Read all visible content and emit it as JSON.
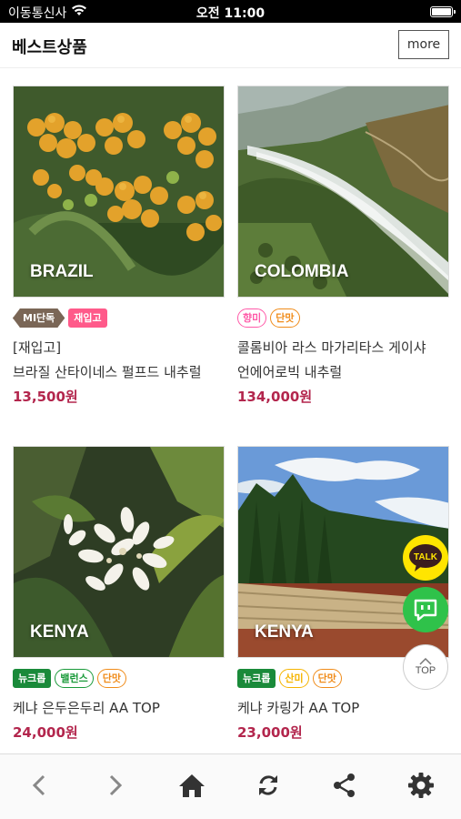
{
  "status_bar": {
    "carrier": "이동통신사",
    "time": "오전 11:00"
  },
  "header": {
    "title": "베스트상품",
    "more_label": "more"
  },
  "products": [
    {
      "region": "BRAZIL",
      "tags": [
        {
          "label": "MI단독",
          "color": "#7a6656",
          "style": "hex-filled"
        },
        {
          "label": "재입고",
          "color": "#ff5a8a",
          "style": "square-filled"
        }
      ],
      "name": "[재입고]\n브라질 산타이네스 펄프드 내추럴",
      "price": "13,500원"
    },
    {
      "region": "COLOMBIA",
      "tags": [
        {
          "label": "향미",
          "color": "#ff5aa8",
          "style": "outline"
        },
        {
          "label": "단맛",
          "color": "#f08c1a",
          "style": "outline"
        }
      ],
      "name": "콜롬비아 라스 마가리타스 게이샤\n언에어로빅 내추럴",
      "price": "134,000원"
    },
    {
      "region": "KENYA",
      "tags": [
        {
          "label": "뉴크롭",
          "color": "#1a8a3a",
          "style": "square-filled"
        },
        {
          "label": "밸런스",
          "color": "#1a9a3a",
          "style": "outline"
        },
        {
          "label": "단맛",
          "color": "#f08c1a",
          "style": "outline"
        }
      ],
      "name": "케냐 은두은두리 AA TOP",
      "price": "24,000원"
    },
    {
      "region": "KENYA",
      "tags": [
        {
          "label": "뉴크롭",
          "color": "#1a8a3a",
          "style": "square-filled"
        },
        {
          "label": "산미",
          "color": "#f5b400",
          "style": "outline"
        },
        {
          "label": "단맛",
          "color": "#f08c1a",
          "style": "outline"
        }
      ],
      "name": "케냐 카링가 AA TOP",
      "price": "23,000원"
    }
  ],
  "floating": {
    "talk_label": "TALK",
    "top_label": "TOP"
  },
  "toolbar": {
    "icons": [
      "back-icon",
      "forward-icon",
      "home-icon",
      "refresh-icon",
      "share-icon",
      "settings-icon"
    ]
  },
  "colors": {
    "price": "#b3264d",
    "talk": "#ffe500",
    "chat": "#2fc24a"
  }
}
